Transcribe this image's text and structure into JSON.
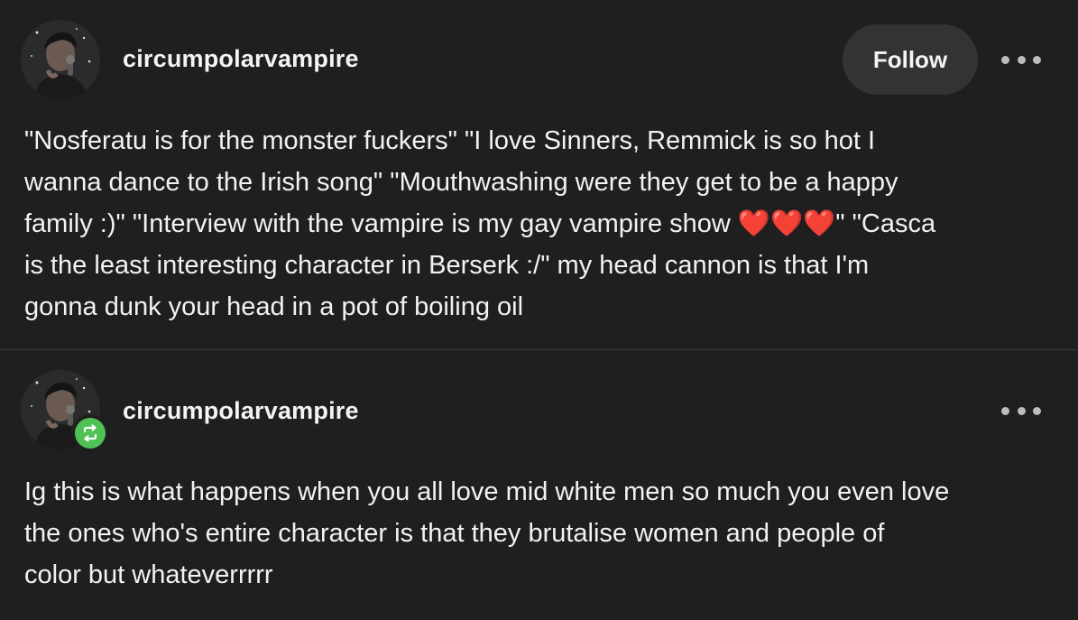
{
  "posts": [
    {
      "username": "circumpolarvampire",
      "follow_label": "Follow",
      "more_icon": "more-horizontal-icon",
      "avatar": "user-avatar",
      "text": "\"Nosferatu is for the monster fuckers\" \"I love Sinners, Remmick is so hot I\nwanna dance to the Irish song\" \"Mouthwashing were they get to be a happy\nfamily :)\" \"Interview with the vampire is my gay vampire show ❤️❤️❤️\" \"Casca\nis the least interesting character in Berserk :/\" my head cannon is that I'm\ngonna dunk your head in a pot of boiling oil"
    },
    {
      "username": "circumpolarvampire",
      "more_icon": "more-horizontal-icon",
      "avatar": "user-avatar",
      "badge_icon": "reblog-icon",
      "badge_color": "#4fc155",
      "text": "Ig this is what happens when you all love mid white men so much you even love\nthe ones who's entire character is that they brutalise women and people of\ncolor but whateverrrrr"
    }
  ],
  "colors": {
    "background": "#1f1f1f",
    "button_bg": "#333333",
    "divider": "#3a3a3a",
    "text": "#f2f2f2"
  }
}
